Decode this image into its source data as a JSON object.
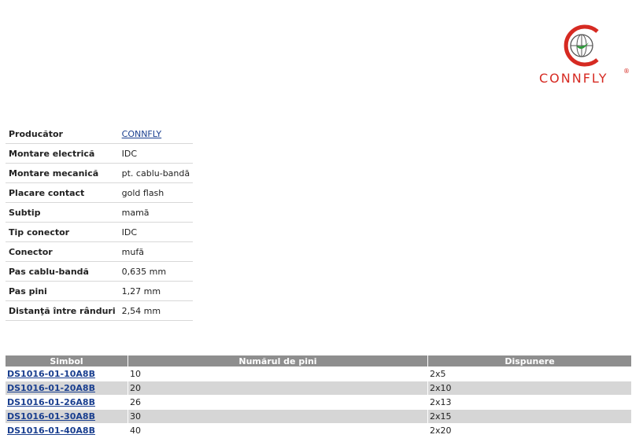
{
  "brand": {
    "name": "CONNFLY",
    "reg_mark": "®",
    "accent_color": "#d62a22"
  },
  "properties": [
    {
      "label": "Producător",
      "value": "CONNFLY",
      "link": true
    },
    {
      "label": "Montare electrică",
      "value": "IDC"
    },
    {
      "label": "Montare mecanică",
      "value": "pt. cablu-bandă"
    },
    {
      "label": "Placare contact",
      "value": "gold flash"
    },
    {
      "label": "Subtip",
      "value": "mamă"
    },
    {
      "label": "Tip conector",
      "value": "IDC"
    },
    {
      "label": "Conector",
      "value": "mufă"
    },
    {
      "label": "Pas cablu-bandă",
      "value": "0,635 mm"
    },
    {
      "label": "Pas pini",
      "value": "1,27 mm"
    },
    {
      "label": "Distanţă între rânduri",
      "value": "2,54 mm"
    }
  ],
  "table": {
    "headers": [
      "Simbol",
      "Numărul de pini",
      "Dispunere"
    ],
    "rows": [
      {
        "symbol": "DS1016-01-10A8B",
        "pins": "10",
        "layout": "2x5"
      },
      {
        "symbol": "DS1016-01-20A8B",
        "pins": "20",
        "layout": "2x10"
      },
      {
        "symbol": "DS1016-01-26A8B",
        "pins": "26",
        "layout": "2x13"
      },
      {
        "symbol": "DS1016-01-30A8B",
        "pins": "30",
        "layout": "2x15"
      },
      {
        "symbol": "DS1016-01-40A8B",
        "pins": "40",
        "layout": "2x20"
      }
    ]
  }
}
